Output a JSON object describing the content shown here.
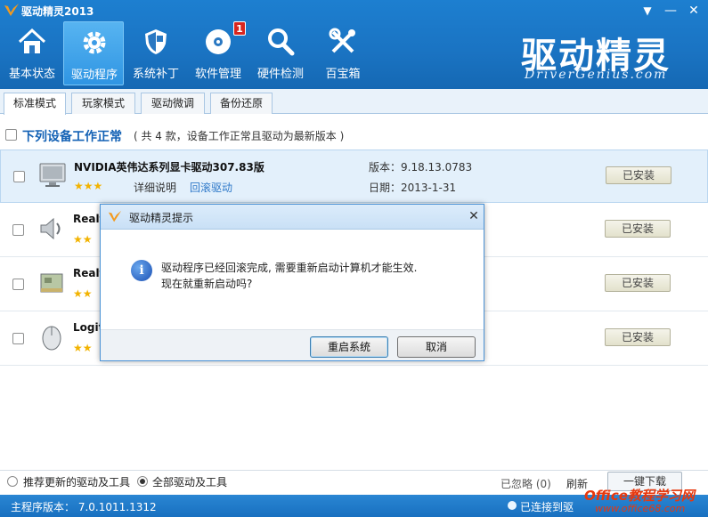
{
  "window": {
    "title": "驱动精灵2013"
  },
  "nav": {
    "items": [
      {
        "label": "基本状态",
        "icon": "home-icon"
      },
      {
        "label": "驱动程序",
        "icon": "gear-icon",
        "active": true
      },
      {
        "label": "系统补丁",
        "icon": "shield-icon"
      },
      {
        "label": "软件管理",
        "icon": "disc-icon",
        "badge": "1"
      },
      {
        "label": "硬件检测",
        "icon": "magnifier-icon"
      },
      {
        "label": "百宝箱",
        "icon": "tools-icon"
      }
    ]
  },
  "brand": {
    "cn": "驱动精灵",
    "en": "DriverGenius.com"
  },
  "tabs": [
    {
      "label": "标准模式",
      "active": true
    },
    {
      "label": "玩家模式"
    },
    {
      "label": "驱动微调"
    },
    {
      "label": "备份还原"
    }
  ],
  "section": {
    "title": "下列设备工作正常",
    "subtitle": "( 共 4 款，设备工作正常且驱动为最新版本 )"
  },
  "devices": [
    {
      "name": "NVIDIA英伟达系列显卡驱动307.83版",
      "stars": "★★★",
      "detail": "详细说明",
      "rollback": "回滚驱动",
      "version": "版本：9.18.13.0783",
      "date": "日期：2013-1-31",
      "status": "已安装"
    },
    {
      "name": "Realt",
      "stars": "★★",
      "status": "已安装"
    },
    {
      "name": "Realt",
      "stars": "★★",
      "status": "已安装"
    },
    {
      "name": "Logit",
      "stars": "★★",
      "status": "已安装"
    }
  ],
  "filters": {
    "option1": "推荐更新的驱动及工具",
    "option2": "全部驱动及工具",
    "ignored": "已忽略 (0)",
    "refresh": "刷新",
    "onekey": "一键下载"
  },
  "status": {
    "version": "主程序版本： 7.0.1011.1312",
    "connection": "已连接到驱"
  },
  "watermark": {
    "line1": "Office教程学习网",
    "line2": "www.office68.com"
  },
  "dialog": {
    "title": "驱动精灵提示",
    "message1": "驱动程序已经回滚完成, 需要重新启动计算机才能生效.",
    "message2": "现在就重新启动吗?",
    "restart": "重启系统",
    "cancel": "取消"
  },
  "colors": {
    "header": "#1a73c2",
    "accent": "#1462b5",
    "link": "#2f79c9",
    "star": "#f2b300"
  }
}
